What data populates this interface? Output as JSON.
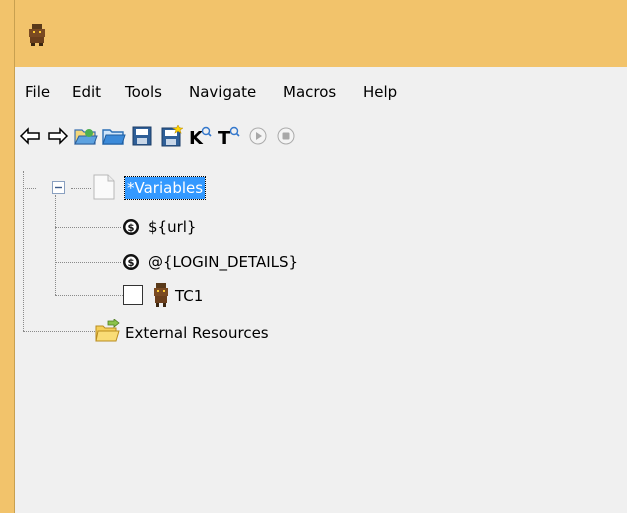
{
  "menu": {
    "file": "File",
    "edit": "Edit",
    "tools": "Tools",
    "navigate": "Navigate",
    "macros": "Macros",
    "help": "Help"
  },
  "toolbar": {
    "icons": [
      "back-arrow-icon",
      "forward-arrow-icon",
      "open-folder-icon",
      "folder-icon",
      "save-icon",
      "save-all-icon",
      "search-keyword-icon",
      "search-test-icon",
      "run-icon",
      "stop-icon"
    ]
  },
  "tree": {
    "root_label": "*Variables",
    "children": [
      {
        "label": "${url}",
        "icon": "scalar-variable-icon"
      },
      {
        "label": "@{LOGIN_DETAILS}",
        "icon": "list-variable-icon"
      },
      {
        "label": "TC1",
        "icon": "robot-test-case-icon",
        "checked": false
      }
    ],
    "external_resources": "External Resources"
  },
  "colors": {
    "title_bar": "#f2c36b",
    "selection": "#3399ff"
  }
}
